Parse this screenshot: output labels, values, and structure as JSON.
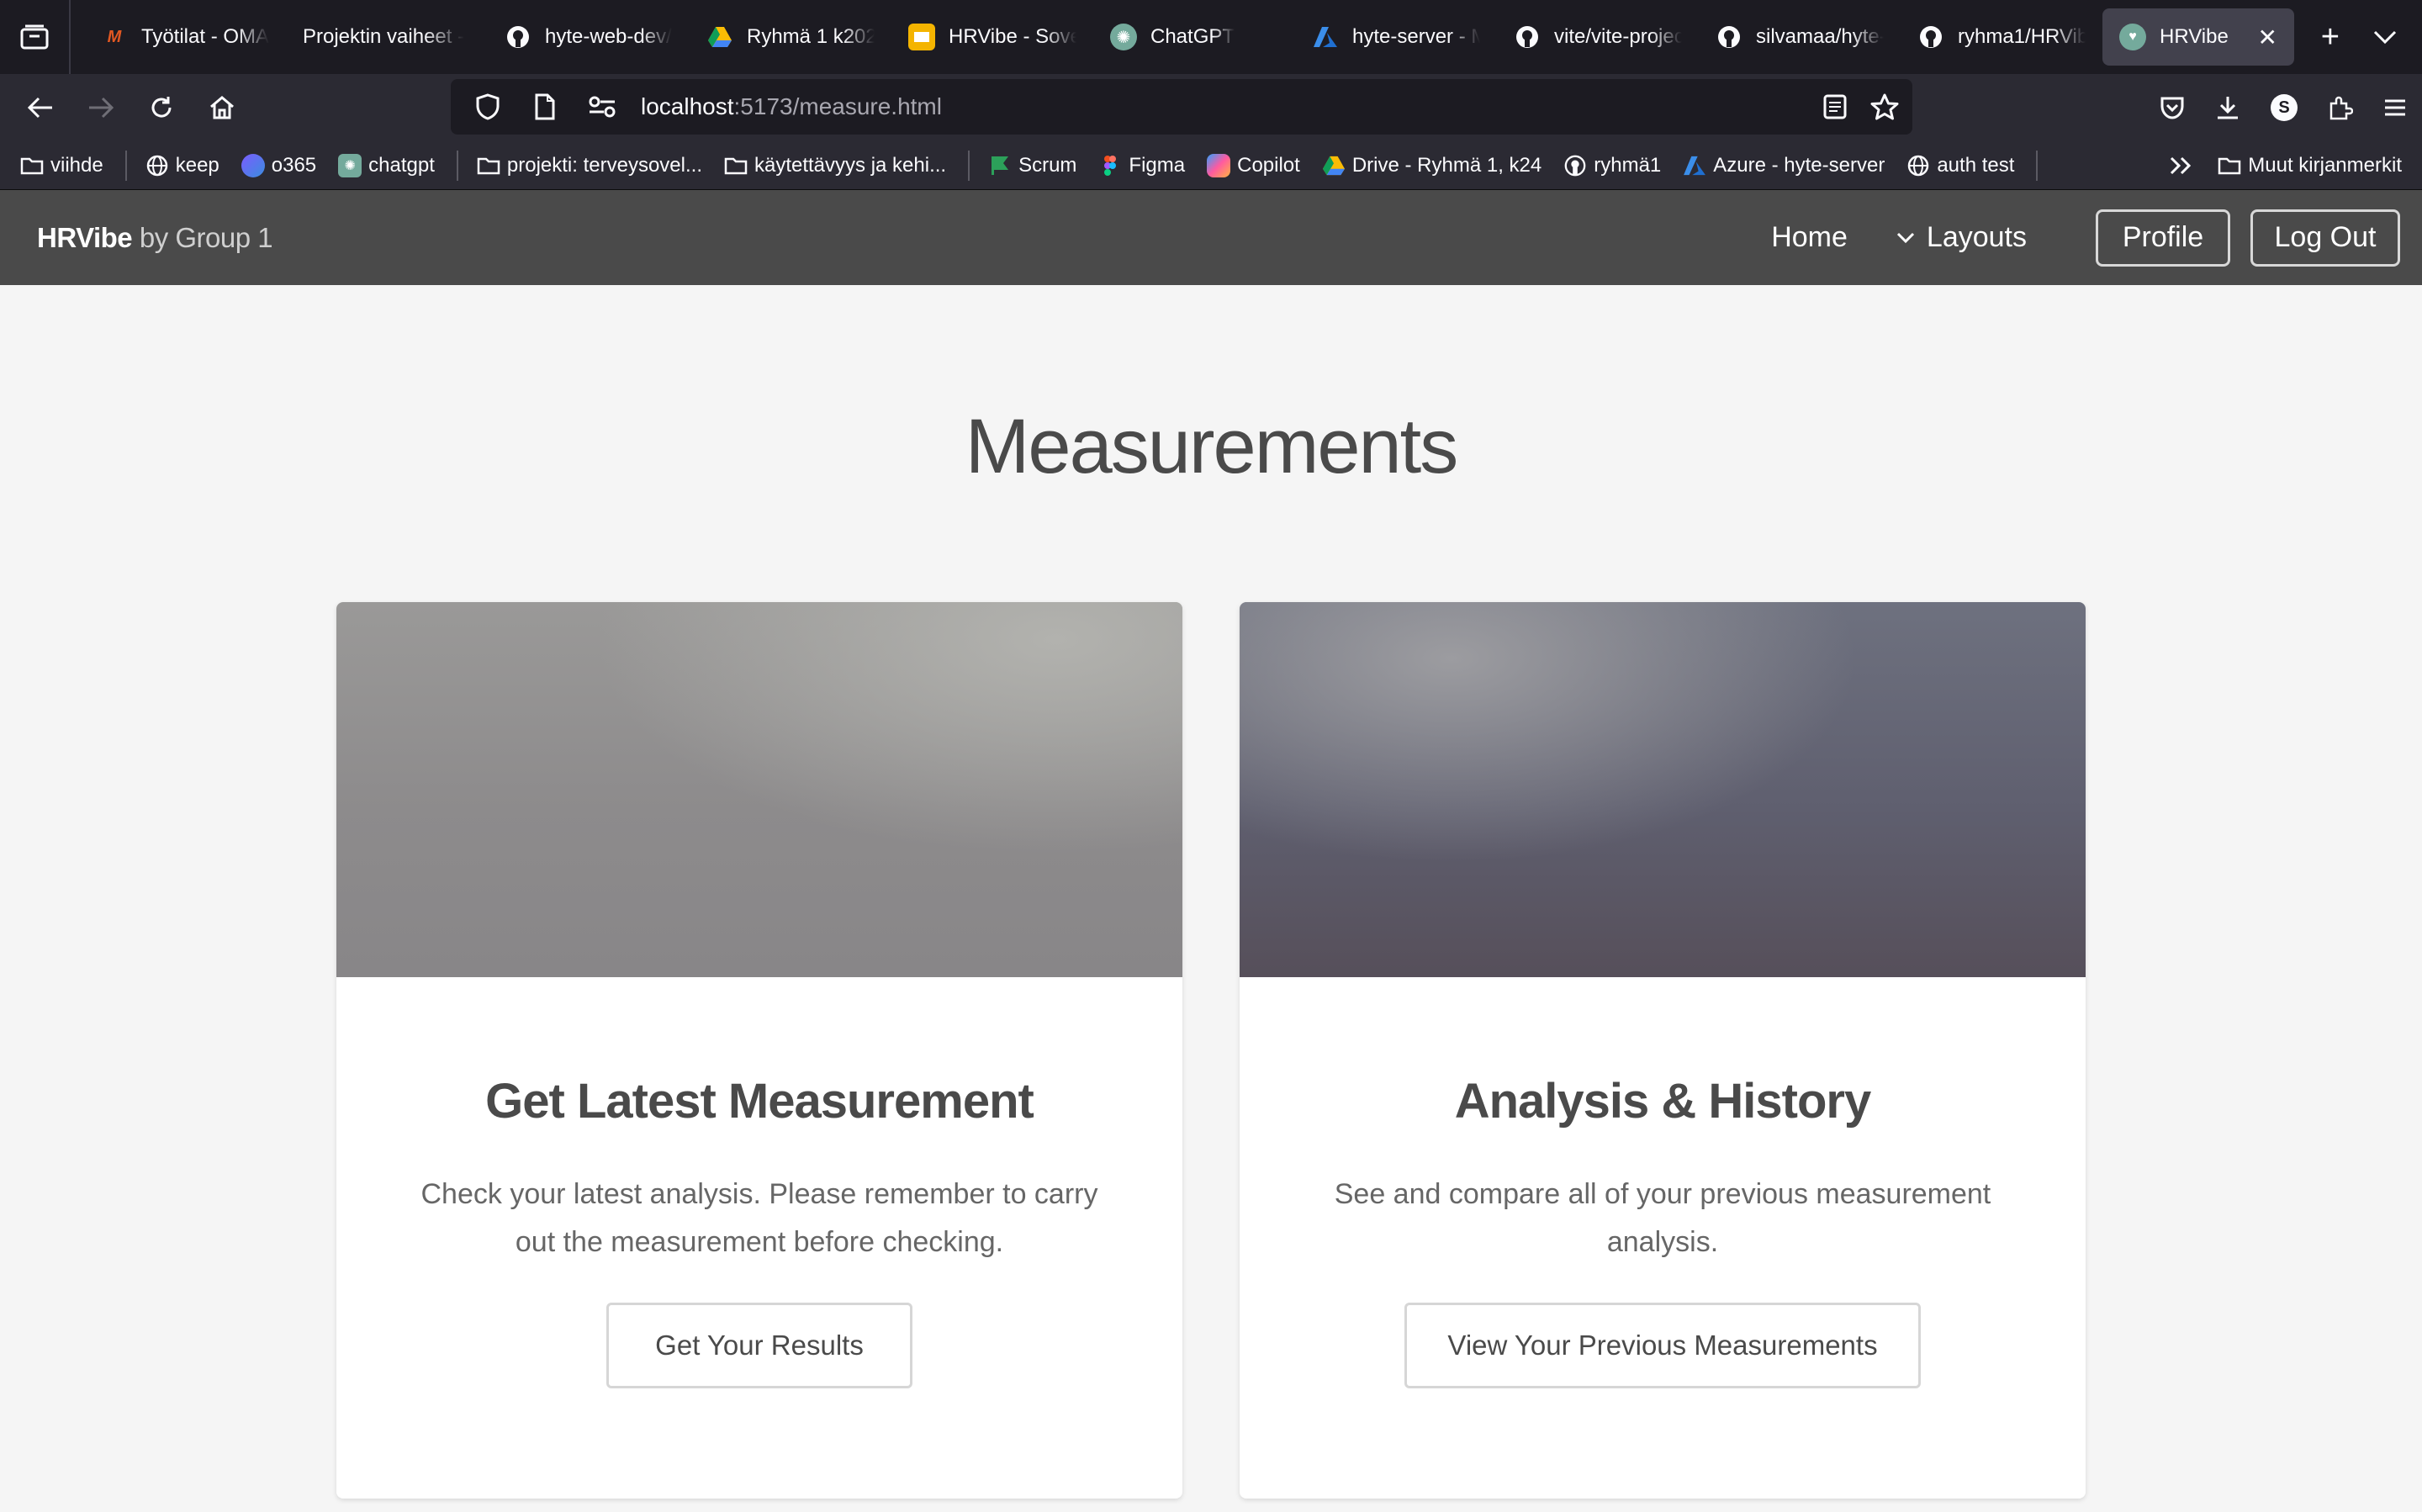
{
  "browser": {
    "tabs": [
      {
        "label": "Työtilat - OMA",
        "icon": "oma-icon",
        "color": "#e25822"
      },
      {
        "label": "Projektin vaiheet -",
        "icon": "",
        "color": ""
      },
      {
        "label": "hyte-web-dev/",
        "icon": "github-icon",
        "color": "#ffffff"
      },
      {
        "label": "Ryhmä 1 k202",
        "icon": "google-drive-icon",
        "color": "#34a853"
      },
      {
        "label": "HRVibe - Sove",
        "icon": "slides-icon",
        "color": "#f4b400"
      },
      {
        "label": "ChatGPT",
        "icon": "chatgpt-icon",
        "color": "#74aa9c"
      },
      {
        "label": "hyte-server - M",
        "icon": "azure-icon",
        "color": "#0078d4"
      },
      {
        "label": "vite/vite-projec",
        "icon": "github-icon",
        "color": "#ffffff"
      },
      {
        "label": "silvamaa/hyte-",
        "icon": "github-icon",
        "color": "#ffffff"
      },
      {
        "label": "ryhma1/HRVibe",
        "icon": "github-icon",
        "color": "#ffffff"
      },
      {
        "label": "HRVibe",
        "icon": "hrvibe-icon",
        "color": "#74aa9c",
        "active": true
      }
    ],
    "url_host": "localhost",
    "url_path": ":5173/measure.html",
    "profile_initial": "S",
    "bookmarks": [
      {
        "label": "viihde",
        "icon": "folder-icon"
      },
      {
        "label": "keep",
        "icon": "globe-icon"
      },
      {
        "label": "o365",
        "icon": "o365-icon"
      },
      {
        "label": "chatgpt",
        "icon": "chatgpt-icon"
      },
      {
        "label": "projekti: terveysovel...",
        "icon": "folder-icon"
      },
      {
        "label": "käytettävyys ja kehi...",
        "icon": "folder-icon"
      },
      {
        "label": "Scrum",
        "icon": "scrum-icon"
      },
      {
        "label": "Figma",
        "icon": "figma-icon"
      },
      {
        "label": "Copilot",
        "icon": "copilot-icon"
      },
      {
        "label": "Drive - Ryhmä 1, k24",
        "icon": "google-drive-icon"
      },
      {
        "label": "ryhmä1",
        "icon": "github-icon"
      },
      {
        "label": "Azure - hyte-server",
        "icon": "azure-icon"
      },
      {
        "label": "auth test",
        "icon": "globe-icon"
      }
    ],
    "other_bookmarks": "Muut kirjanmerkit"
  },
  "site": {
    "brand_name": "HRVibe",
    "brand_suffix": " by Group 1",
    "nav": {
      "home": "Home",
      "layouts": "Layouts",
      "profile": "Profile",
      "logout": "Log Out"
    }
  },
  "main": {
    "title": "Measurements",
    "cards": [
      {
        "title": "Get Latest Measurement",
        "text": "Check your latest analysis. Please remember to carry out the measurement before checking.",
        "button": "Get Your Results"
      },
      {
        "title": "Analysis & History",
        "text": "See and compare all of your previous measurement analysis.",
        "button": "View Your Previous Measurements"
      }
    ]
  }
}
